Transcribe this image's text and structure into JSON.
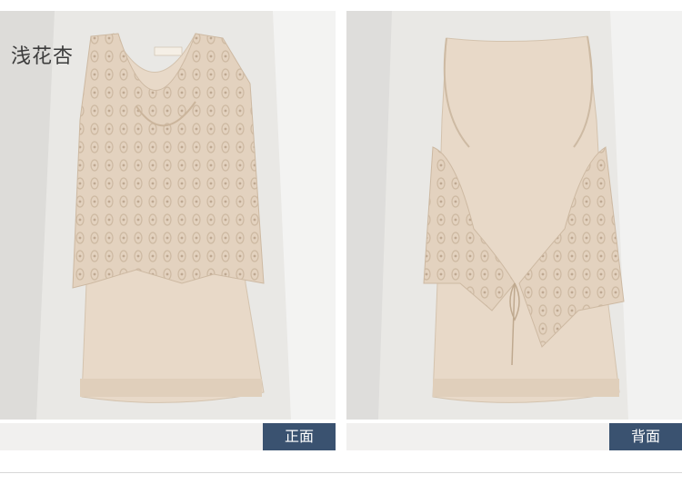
{
  "product": {
    "color_name": "浅花杏",
    "garment_color": "#e5d5c3"
  },
  "views": [
    {
      "label": "正面",
      "side": "front"
    },
    {
      "label": "背面",
      "side": "back"
    }
  ],
  "garment_tag": "XIAO"
}
